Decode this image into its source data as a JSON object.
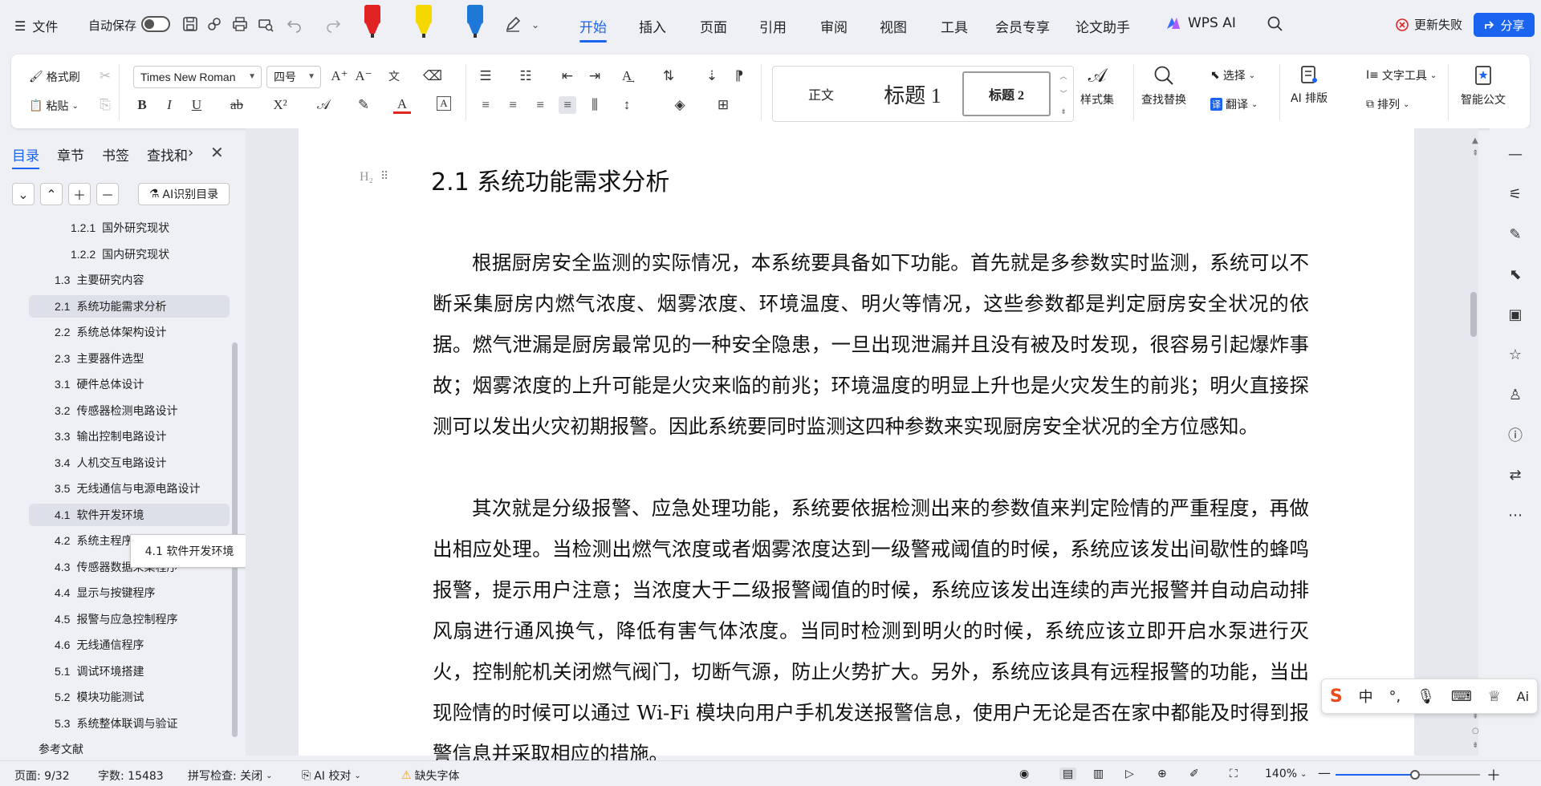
{
  "menubar": {
    "file": "文件",
    "autosave": "自动保存",
    "tabs": [
      "开始",
      "插入",
      "页面",
      "引用",
      "审阅",
      "视图",
      "工具",
      "会员专享",
      "论文助手"
    ],
    "wps_ai": "WPS AI",
    "update": "更新失败",
    "share": "分享"
  },
  "ribbon": {
    "format_painter": "格式刷",
    "paste": "粘贴",
    "font_name": "Times New Roman",
    "font_size": "四号",
    "styles": {
      "normal": "正文",
      "heading1": "标题 1",
      "heading2": "标题 2"
    },
    "style_set": "样式集",
    "find_replace": "查找替换",
    "select": "选择",
    "translate": "翻译",
    "ai_layout": "AI 排版",
    "text_tools": "文字工具",
    "arrange": "排列",
    "smart_doc": "智能公文"
  },
  "nav": {
    "tabs": [
      "目录",
      "章节",
      "书签",
      "查找和"
    ],
    "ai_recognize": "AI识别目录",
    "toc": [
      {
        "num": "1.2.1",
        "text": "国外研究现状",
        "level": 3
      },
      {
        "num": "1.2.2",
        "text": "国内研究现状",
        "level": 3
      },
      {
        "num": "1.3",
        "text": "主要研究内容",
        "level": 2
      },
      {
        "num": "2.1",
        "text": "系统功能需求分析",
        "level": 2
      },
      {
        "num": "2.2",
        "text": "系统总体架构设计",
        "level": 2
      },
      {
        "num": "2.3",
        "text": "主要器件选型",
        "level": 2
      },
      {
        "num": "3.1",
        "text": "硬件总体设计",
        "level": 2
      },
      {
        "num": "3.2",
        "text": "传感器检测电路设计",
        "level": 2
      },
      {
        "num": "3.3",
        "text": "输出控制电路设计",
        "level": 2
      },
      {
        "num": "3.4",
        "text": "人机交互电路设计",
        "level": 2
      },
      {
        "num": "3.5",
        "text": "无线通信与电源电路设计",
        "level": 2
      },
      {
        "num": "4.1",
        "text": "软件开发环境",
        "level": 2
      },
      {
        "num": "4.2",
        "text": "系统主程序设计",
        "level": 2
      },
      {
        "num": "4.3",
        "text": "传感器数据采集程序",
        "level": 2
      },
      {
        "num": "4.4",
        "text": "显示与按键程序",
        "level": 2
      },
      {
        "num": "4.5",
        "text": "报警与应急控制程序",
        "level": 2
      },
      {
        "num": "4.6",
        "text": "无线通信程序",
        "level": 2
      },
      {
        "num": "5.1",
        "text": "调试环境搭建",
        "level": 2
      },
      {
        "num": "5.2",
        "text": "模块功能测试",
        "level": 2
      },
      {
        "num": "5.3",
        "text": "系统整体联调与验证",
        "level": 2
      },
      {
        "num": "",
        "text": "参考文献",
        "level": 1
      }
    ],
    "tooltip": "4.1 软件开发环境"
  },
  "document": {
    "heading_marker": "H₂",
    "heading": "2.1  系统功能需求分析",
    "para1": "根据厨房安全监测的实际情况，本系统要具备如下功能。首先就是多参数实时监测，系统可以不断采集厨房内燃气浓度、烟雾浓度、环境温度、明火等情况，这些参数都是判定厨房安全状况的依据。燃气泄漏是厨房最常见的一种安全隐患，一旦出现泄漏并且没有被及时发现，很容易引起爆炸事故；烟雾浓度的上升可能是火灾来临的前兆；环境温度的明显上升也是火灾发生的前兆；明火直接探测可以发出火灾初期报警。因此系统要同时监测这四种参数来实现厨房安全状况的全方位感知。",
    "para2": "其次就是分级报警、应急处理功能，系统要依据检测出来的参数值来判定险情的严重程度，再做出相应处理。当检测出燃气浓度或者烟雾浓度达到一级警戒阈值的时候，系统应该发出间歇性的蜂鸣报警，提示用户注意；当浓度大于二级报警阈值的时候，系统应该发出连续的声光报警并自动启动排风扇进行通风换气，降低有害气体浓度。当同时检测到明火的时候，系统应该立即开启水泵进行灭火，控制舵机关闭燃气阀门，切断气源，防止火势扩大。另外，系统应该具有远程报警的功能，当出现险情的时候可以通过 Wi-Fi 模块向用户手机发送报警信息，使用户无论是否在家中都能及时得到报警信息并采取相应的措施。"
  },
  "ime": {
    "mode": "中"
  },
  "status": {
    "page": "页面: 9/32",
    "words": "字数: 15483",
    "spell": "拼写检查: 关闭",
    "ai_check": "AI 校对",
    "missing_font": "缺失字体",
    "zoom": "140%",
    "zoom_level": 0.55
  },
  "colors": {
    "accent": "#1a64f0",
    "pen_red": "#e02424",
    "pen_yellow": "#f5d800",
    "pen_blue": "#1e78d8"
  }
}
